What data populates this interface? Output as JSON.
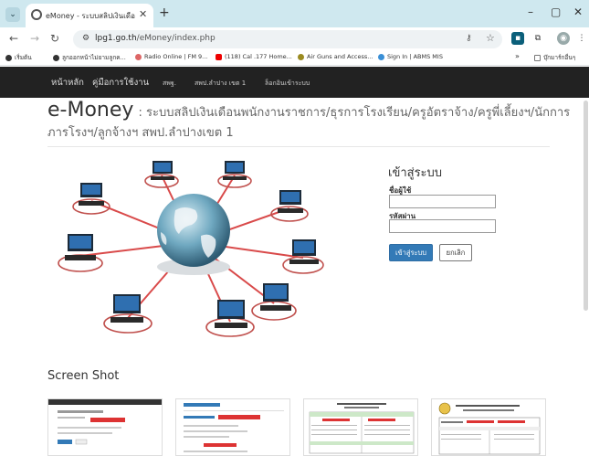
{
  "browser": {
    "tab_title": "eMoney - ระบบสลิปเงินเดือนพนักงาน",
    "new_tab": "+",
    "url_host": "lpg1.go.th",
    "url_path": "/eMoney/index.php",
    "window_controls": [
      "–",
      "▢",
      "✕"
    ]
  },
  "bookmarks": [
    {
      "label": "เริ่มต้น",
      "color": "#333333"
    },
    {
      "label": "ลูกออกหน้าไม่ยามลูกค...",
      "color": "#333333"
    },
    {
      "label": "Radio Online | FM 9...",
      "color": "#d66"
    },
    {
      "label": "(118) Cal .177 Home...",
      "color": "#e00"
    },
    {
      "label": "Air Guns and Access...",
      "color": "#9a8a20"
    },
    {
      "label": "Sign In | ABMS MIS",
      "color": "#3a8fd6"
    },
    {
      "label": "บุ๊กมาร์กอื่นๆ",
      "color": "#777777"
    }
  ],
  "site_nav": {
    "items": [
      "หน้าหลัก",
      "คู่มือการใช้งาน",
      "สพฐ.",
      "สพป.ลำปาง เขต 1",
      "ล็อกอินเข้าระบบ"
    ]
  },
  "header": {
    "title": "e-Money",
    "subtitle_line1": ": ระบบสลิปเงินเดือนพนักงานราชการ/ธุรการโรงเรียน/ครูอัตราจ้าง/ครูพี่เลี้ยงฯ/นักการ",
    "subtitle_line2": "ภารโรงฯ/ลูกจ้างฯ สพป.ลำปางเขต 1"
  },
  "login": {
    "title": "เข้าสู่ระบบ",
    "username_label": "ชื่อผู้ใช้",
    "username_value": "",
    "password_label": "รหัสผ่าน",
    "password_value": "",
    "login_button": "เข้าสู่ระบบ",
    "reset_button": "ยกเลิก"
  },
  "screenshots": {
    "title": "Screen Shot"
  },
  "colors": {
    "tabstrip": "#cfe8ef",
    "navbar": "#222222",
    "primary": "#337ab7"
  }
}
